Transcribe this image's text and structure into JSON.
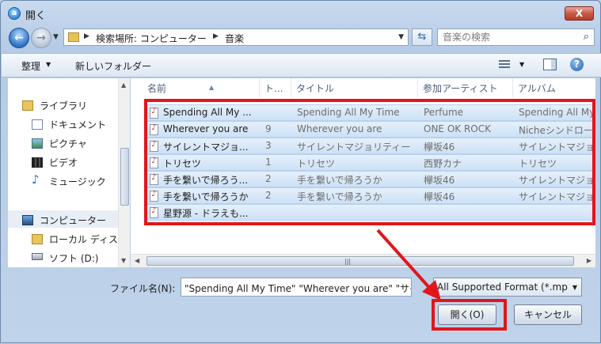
{
  "window": {
    "title": "開く",
    "close_label": "X"
  },
  "nav": {
    "breadcrumb": [
      "検索場所: コンピューター",
      "音楽"
    ],
    "search_placeholder": "音楽の検索"
  },
  "toolbar": {
    "organize_label": "整理",
    "new_folder_label": "新しいフォルダー"
  },
  "sidebar": {
    "items": [
      {
        "label": "ライブラリ",
        "icon": "library-icon"
      },
      {
        "label": "ドキュメント",
        "icon": "document-icon"
      },
      {
        "label": "ピクチャ",
        "icon": "picture-icon"
      },
      {
        "label": "ビデオ",
        "icon": "video-icon"
      },
      {
        "label": "ミュージック",
        "icon": "music-icon"
      },
      {
        "label": "コンピューター",
        "icon": "computer-icon"
      },
      {
        "label": "ローカル ディス",
        "icon": "local-disk-icon"
      },
      {
        "label": "ソフト (D:)",
        "icon": "drive-icon"
      }
    ]
  },
  "columns": [
    "名前",
    "ト...",
    "タイトル",
    "参加アーティスト",
    "アルバム"
  ],
  "files": [
    {
      "name": "Spending All My ...",
      "track": "",
      "title": "Spending All My Time",
      "artist": "Perfume",
      "album": "Spending All My"
    },
    {
      "name": "Wherever you are",
      "track": "9",
      "title": "Wherever you are",
      "artist": "ONE OK ROCK",
      "album": "Nicheシンドロー"
    },
    {
      "name": "サイレントマジョ...",
      "track": "3",
      "title": "サイレントマジョリティー",
      "artist": "欅坂46",
      "album": "サイレントマジョ"
    },
    {
      "name": "トリセツ",
      "track": "1",
      "title": "トリセツ",
      "artist": "西野カナ",
      "album": "トリセツ"
    },
    {
      "name": "手を繋いで帰ろう...",
      "track": "2",
      "title": "手を繋いで帰ろうか",
      "artist": "欅坂46",
      "album": "サイレントマジョ"
    },
    {
      "name": "手を繋いで帰ろうか",
      "track": "2",
      "title": "手を繋いで帰ろうか",
      "artist": "欅坂46",
      "album": "サイレントマジョ"
    },
    {
      "name": "星野源 - ドラえも...",
      "track": "",
      "title": "",
      "artist": "",
      "album": ""
    }
  ],
  "footer": {
    "filename_label": "ファイル名(N):",
    "filename_value": "\"Spending All My Time\" \"Wherever you are\" \"サイ",
    "filter_value": "All Supported Format (*.mp",
    "open_label": "開く(O)",
    "cancel_label": "キャンセル"
  },
  "annotation": {
    "highlight_color": "#e1161c"
  }
}
